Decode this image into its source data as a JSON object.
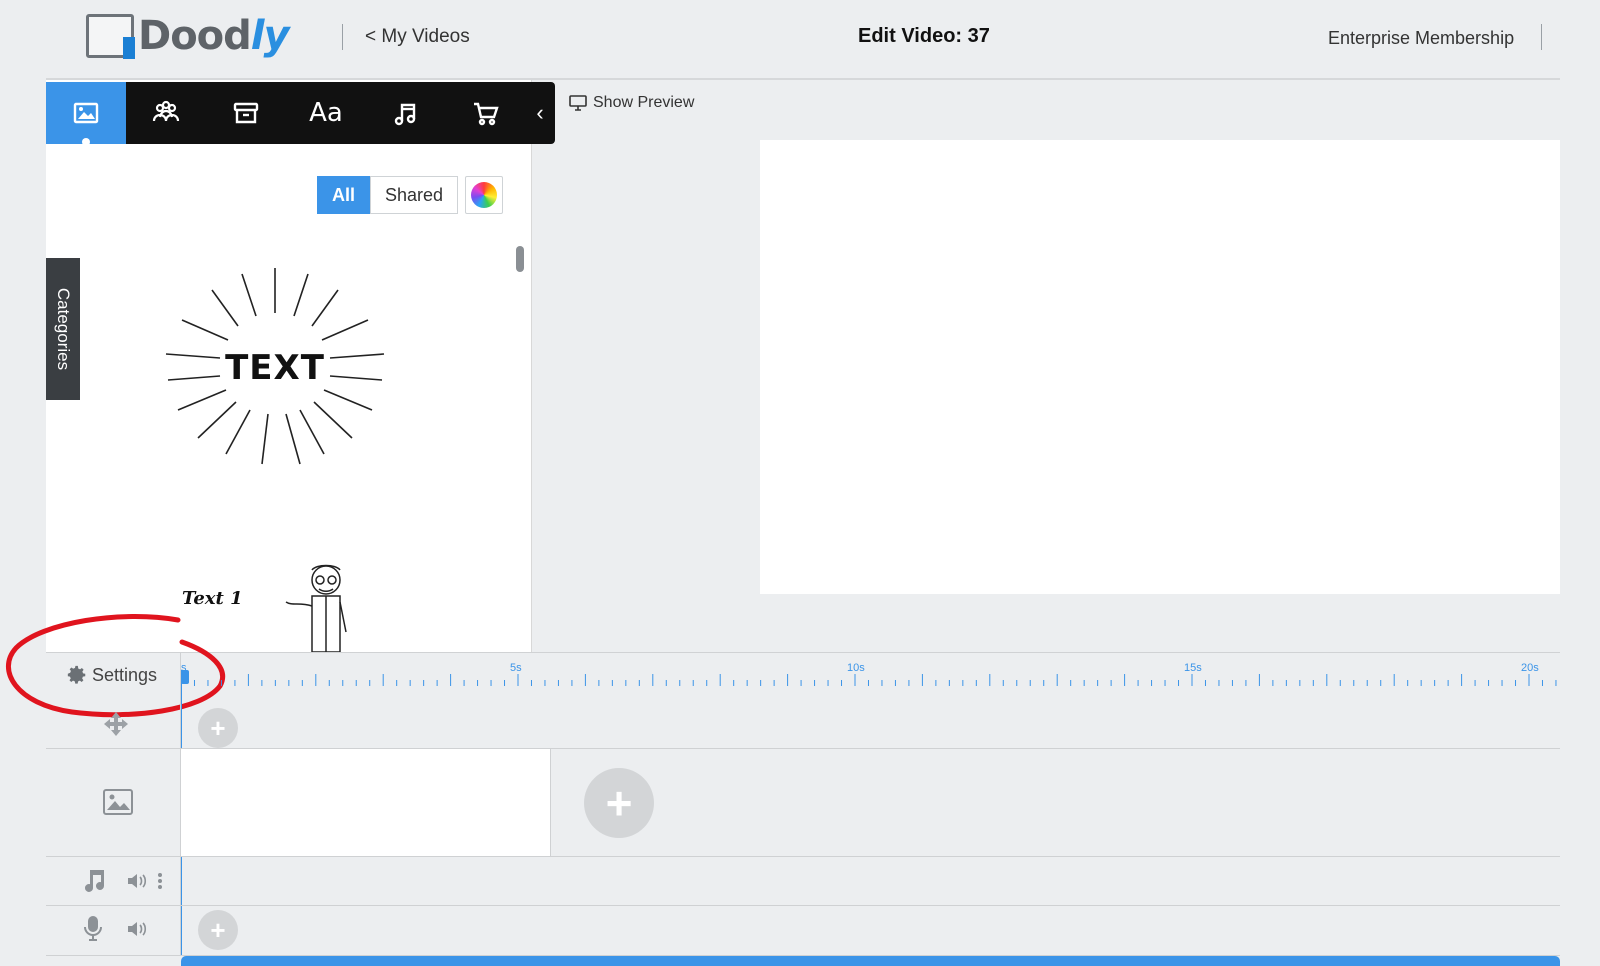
{
  "header": {
    "logo_text_main": "Dood",
    "logo_text_accent": "ly",
    "back_link": "< My Videos",
    "edit_title": "Edit Video: 37",
    "membership": "Enterprise Membership"
  },
  "toolbar": {
    "tools": [
      {
        "name": "image-icon",
        "active": true
      },
      {
        "name": "characters-icon",
        "active": false
      },
      {
        "name": "props-icon",
        "active": false
      },
      {
        "name": "text-icon",
        "label": "Aa",
        "active": false
      },
      {
        "name": "music-icon",
        "active": false
      },
      {
        "name": "cart-icon",
        "active": false
      }
    ],
    "collapse": "‹"
  },
  "filters": {
    "all": "All",
    "shared": "Shared"
  },
  "categories_tab": "Categories",
  "assets": {
    "burst_text": "TEXT",
    "character_label": "Text 1"
  },
  "preview": {
    "show_preview": "Show Preview"
  },
  "timeline": {
    "settings": "Settings",
    "ruler_marks": [
      "s",
      "5s",
      "10s",
      "15s",
      "20s"
    ],
    "add_label": "+"
  },
  "colors": {
    "accent": "#3b94e8",
    "toolbar_bg": "#111111",
    "annotation_red": "#e0141e"
  }
}
